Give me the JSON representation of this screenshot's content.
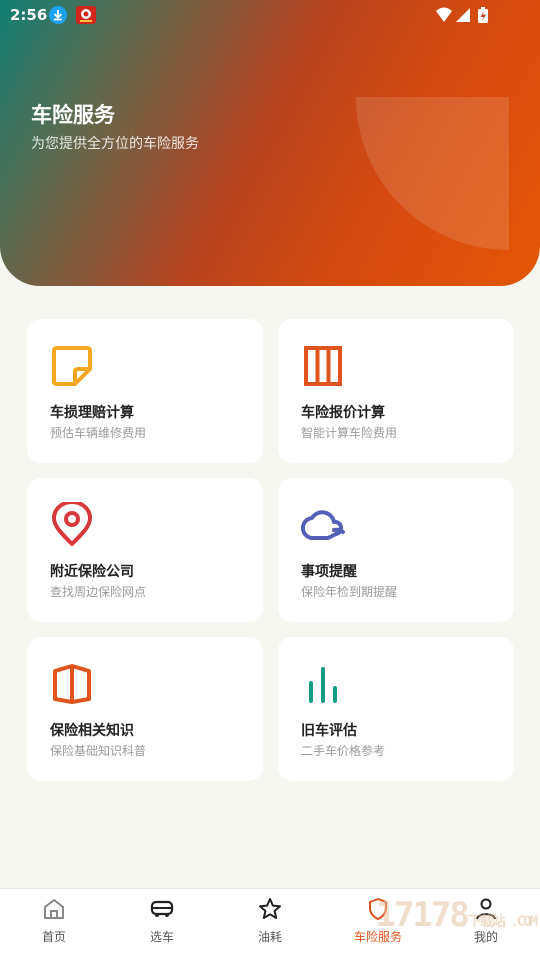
{
  "status": {
    "time": "2:56"
  },
  "hero": {
    "title": "车险服务",
    "subtitle": "为您提供全方位的车险服务"
  },
  "cards": [
    {
      "title": "车损理赔计算",
      "subtitle": "预估车辆维修费用",
      "icon": "note-icon",
      "color": "#f5a623"
    },
    {
      "title": "车险报价计算",
      "subtitle": "智能计算车险费用",
      "icon": "columns-icon",
      "color": "#e2541d"
    },
    {
      "title": "附近保险公司",
      "subtitle": "查找周边保险网点",
      "icon": "location-pin-icon",
      "color": "#d9383a"
    },
    {
      "title": "事项提醒",
      "subtitle": "保险年检到期提醒",
      "icon": "cloud-icon",
      "color": "#5560b8"
    },
    {
      "title": "保险相关知识",
      "subtitle": "保险基础知识科普",
      "icon": "book-icon",
      "color": "#e2541d"
    },
    {
      "title": "旧车评估",
      "subtitle": "二手车价格参考",
      "icon": "bar-chart-icon",
      "color": "#159a86"
    }
  ],
  "nav": {
    "items": [
      {
        "label": "首页",
        "icon": "home-icon"
      },
      {
        "label": "选车",
        "icon": "car-icon"
      },
      {
        "label": "油耗",
        "icon": "star-icon"
      },
      {
        "label": "车险服务",
        "icon": "shield-icon"
      },
      {
        "label": "我的",
        "icon": "person-icon"
      }
    ],
    "active_index": 3
  },
  "watermark": {
    "text": "17178",
    "suffix": "下载站 .COM"
  }
}
